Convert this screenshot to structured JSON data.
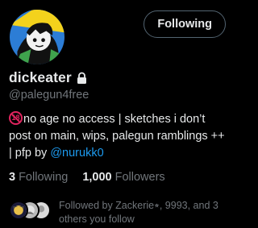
{
  "profile": {
    "display_name": "dickeater",
    "handle": "@palegun4free",
    "follow_button_label": "Following",
    "bio": {
      "age_badge": "18",
      "text": "no age no access | sketches i don’t post on main, wips, palegun ramblings ++ | pfp by ",
      "mention": "@nurukk0"
    }
  },
  "stats": {
    "following_count": "3",
    "following_label": "Following",
    "followers_count": "1,000",
    "followers_label": "Followers"
  },
  "followed_by": {
    "text": "Followed by Zackerie⭒, 9993, and 3 others you follow"
  },
  "colors": {
    "background": "#000000",
    "text_primary": "#e7e9ea",
    "text_secondary": "#71767b",
    "accent_link": "#1d9bf0",
    "age_badge_red": "#e0245e"
  },
  "icons": [
    "lock-icon",
    "age-restriction-icon"
  ]
}
